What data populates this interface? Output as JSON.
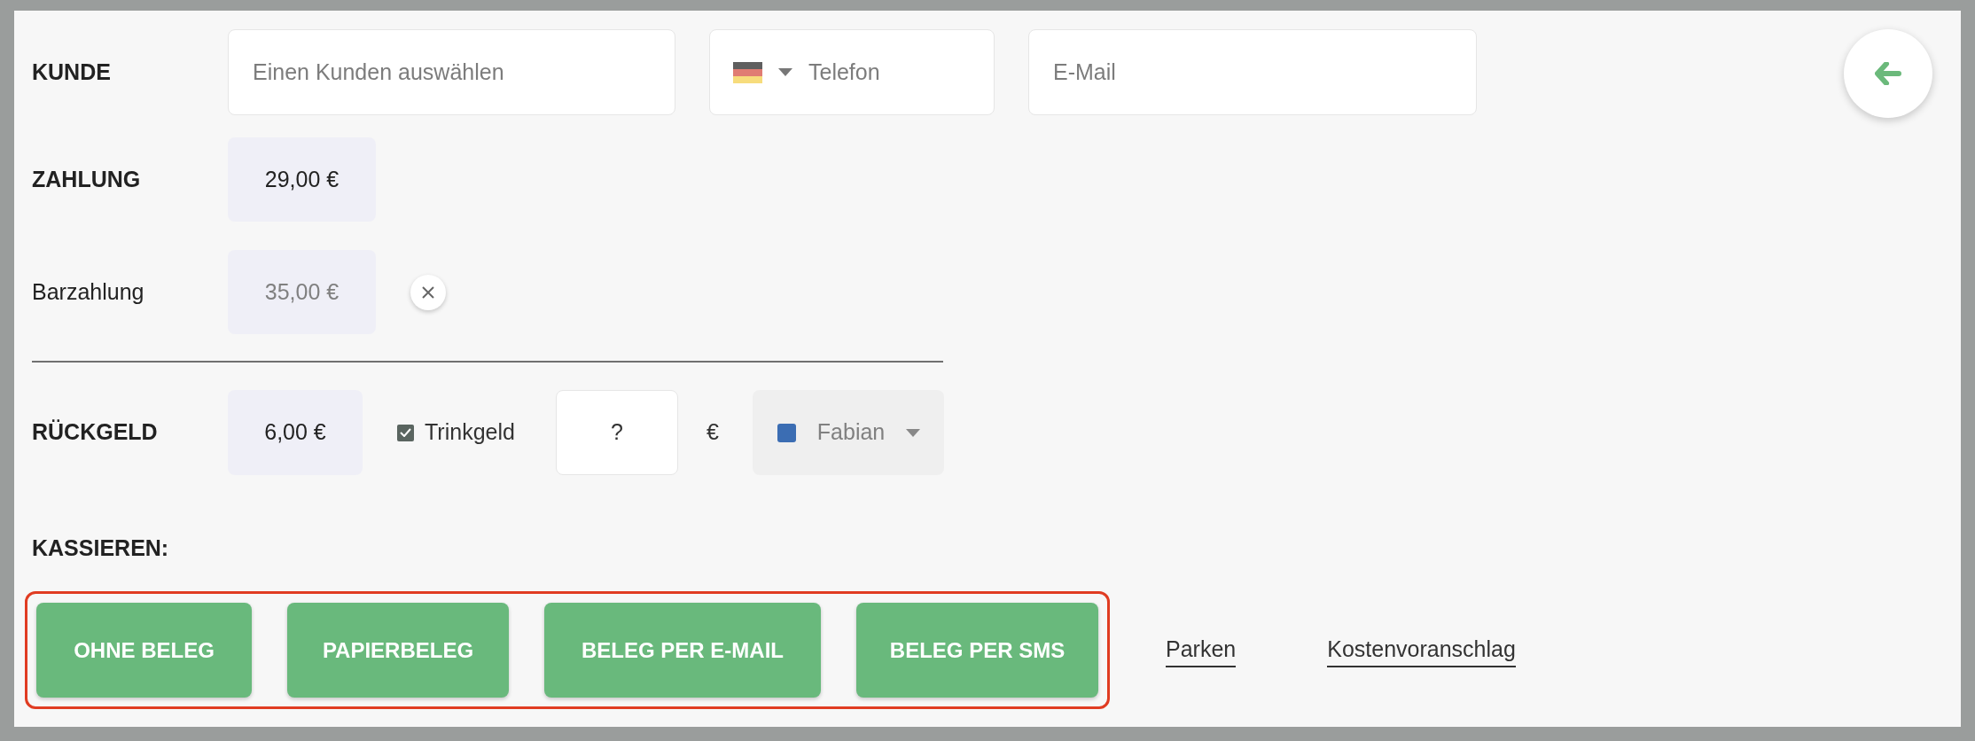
{
  "customer": {
    "label": "KUNDE",
    "name_placeholder": "Einen Kunden auswählen",
    "phone_placeholder": "Telefon",
    "email_placeholder": "E-Mail"
  },
  "payment": {
    "label": "ZAHLUNG",
    "total": "29,00 €"
  },
  "cash": {
    "label": "Barzahlung",
    "amount": "35,00 €"
  },
  "change": {
    "label": "RÜCKGELD",
    "amount": "6,00 €",
    "tip_label": "Trinkgeld",
    "tip_checked": true,
    "tip_value": "?",
    "currency": "€",
    "staff": {
      "name": "Fabian",
      "color": "#3b6db3"
    }
  },
  "checkout": {
    "label": "KASSIEREN:",
    "highlighted": true,
    "buttons": [
      "OHNE BELEG",
      "PAPIERBELEG",
      "BELEG PER E-MAIL",
      "BELEG PER SMS"
    ],
    "links": [
      "Parken",
      "Kostenvoranschlag"
    ]
  }
}
